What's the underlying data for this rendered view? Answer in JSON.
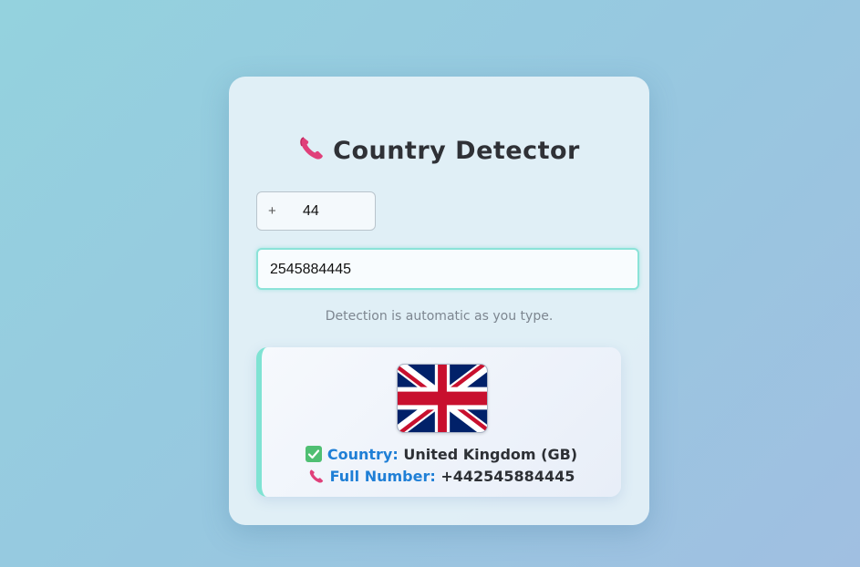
{
  "app": {
    "title": "Country Detector",
    "title_icon": "phone-icon"
  },
  "code_field": {
    "prefix": "+",
    "value": "44"
  },
  "number_field": {
    "value": "2545884445"
  },
  "hint": "Detection is automatic as you type.",
  "result": {
    "flag": "united-kingdom-flag",
    "country_icon": "check-icon",
    "country_label": "Country:",
    "country_value": "United Kingdom (GB)",
    "number_icon": "phone-icon",
    "number_label": "Full Number:",
    "number_value": "+442545884445"
  },
  "colors": {
    "accent": "#1f7fd6",
    "input_focus_border": "#8be3d8",
    "result_border": "#7fe3d3",
    "phone_icon": "#e0407a",
    "check_icon": "#4fbf73"
  }
}
